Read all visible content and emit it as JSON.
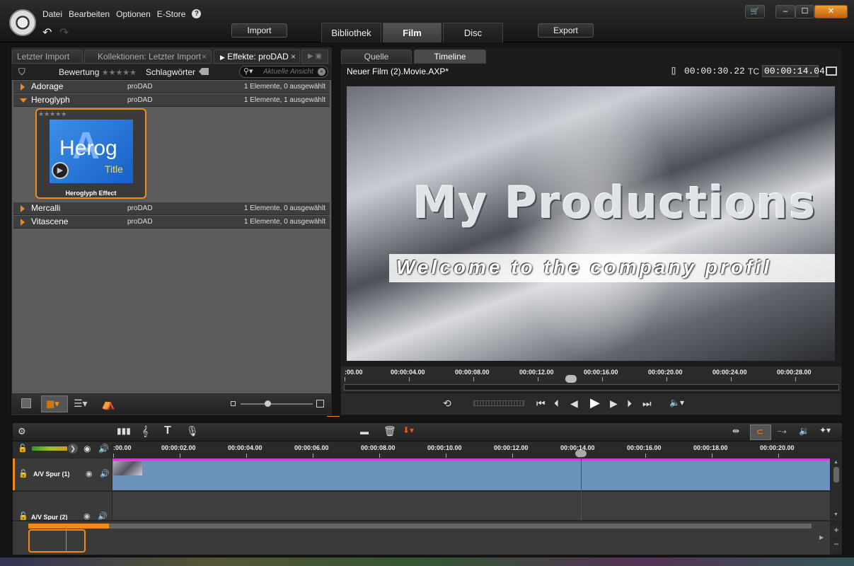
{
  "menu": {
    "items": [
      "Datei",
      "Bearbeiten",
      "Optionen",
      "E-Store"
    ],
    "help": "?"
  },
  "toolbar": {
    "import": "Import",
    "export": "Export",
    "tabs": [
      "Bibliothek",
      "Film",
      "Disc"
    ]
  },
  "window": {
    "minimize": "–",
    "maximize": "☐",
    "close": "✕",
    "cart": "🛒"
  },
  "library": {
    "tabs": [
      "Letzter Import",
      "Kollektionen: Letzter Import",
      "Effekte: proDAD"
    ],
    "rating_label": "Bewertung",
    "stars": "★★★★★",
    "keywords_label": "Schlagwörter",
    "search_placeholder": "Aktuelle Ansicht",
    "rows": [
      {
        "name": "Adorage",
        "vendor": "proDAD",
        "count": "1 Elemente, 0 ausgewählt"
      },
      {
        "name": "Heroglyph",
        "vendor": "proDAD",
        "count": "1 Elemente, 1 ausgewählt"
      },
      {
        "name": "Mercalli",
        "vendor": "proDAD",
        "count": "1 Elemente, 0 ausgewählt"
      },
      {
        "name": "Vitascene",
        "vendor": "proDAD",
        "count": "1 Elemente, 0 ausgewählt"
      }
    ],
    "thumb": {
      "title": "Heroglyph Effect",
      "big": "Herog",
      "sub": "Title"
    }
  },
  "preview": {
    "tabs": [
      "Quelle",
      "Timeline"
    ],
    "project": "Neuer Film (2).Movie.AXP*",
    "duration_label": "[]",
    "duration": "00:00:30.22",
    "tc_label": "TC",
    "tc": "00:00:14.04",
    "title_line": "My Productions",
    "subtitle": "Welcome to the company profil",
    "ticks": [
      ":00.00",
      "00:00:04.00",
      "00:00:08.00",
      "00:00:12.00",
      "00:00:16.00",
      "00:00:20.00",
      "00:00:24.00",
      "00:00:28.00"
    ]
  },
  "timeline": {
    "ticks": [
      ":00.00",
      "00:00:02.00",
      "00:00:04.00",
      "00:00:06.00",
      "00:00:08.00",
      "00:00:10.00",
      "00:00:12.00",
      "00:00:14.00",
      "00:00:16.00",
      "00:00:18.00",
      "00:00:20.00"
    ],
    "tracks": [
      "A/V Spur (1)",
      "A/V Spur (2)"
    ],
    "playhead_time": "00:00:14.00"
  },
  "colors": {
    "accent": "#f08a1c",
    "clip": "#6b92b8",
    "magenta": "#d63ad6"
  }
}
